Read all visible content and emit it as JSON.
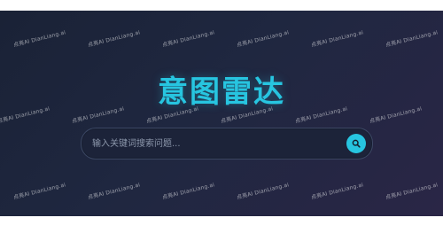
{
  "app": {
    "title": "意图雷达"
  },
  "search": {
    "placeholder": "输入关键词搜索问题..."
  },
  "watermark": {
    "text": "点亮AI  DianLiang.ai"
  },
  "colors": {
    "accent": "#27c5e0",
    "background": "#1f2740"
  },
  "icons": {
    "search_button": "search-icon"
  }
}
